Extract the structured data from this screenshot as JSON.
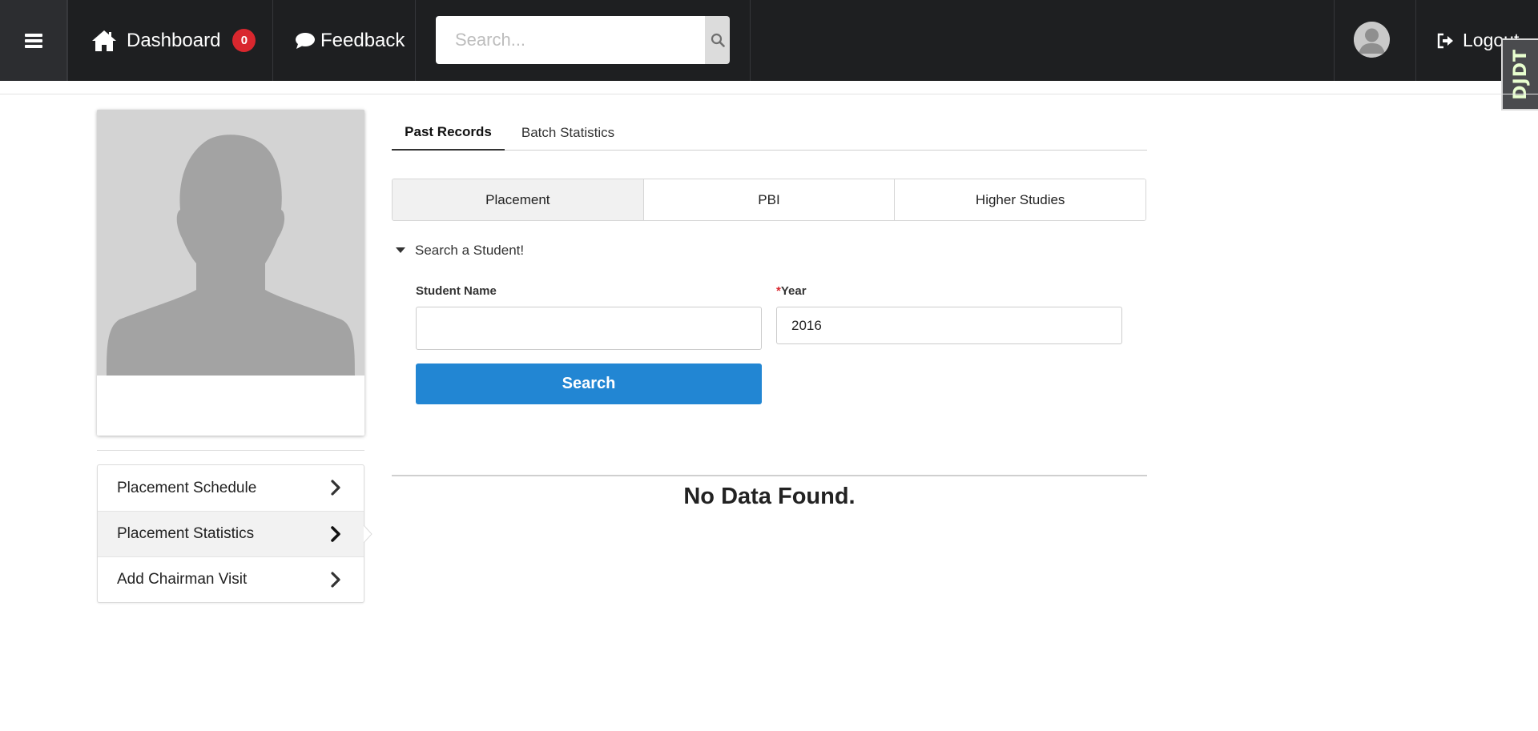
{
  "navbar": {
    "dashboard_label": "Dashboard",
    "notification_count": "0",
    "feedback_label": "Feedback",
    "search_placeholder": "Search...",
    "logout_label": "Logout",
    "extension_label": "DJDT"
  },
  "sidebar": {
    "items": [
      {
        "label": "Placement Schedule",
        "active": false
      },
      {
        "label": "Placement Statistics",
        "active": true
      },
      {
        "label": "Add Chairman Visit",
        "active": false
      }
    ]
  },
  "tabs": [
    {
      "label": "Past Records",
      "active": true
    },
    {
      "label": "Batch Statistics",
      "active": false
    }
  ],
  "segments": [
    {
      "label": "Placement",
      "active": true
    },
    {
      "label": "PBI",
      "active": false
    },
    {
      "label": "Higher Studies",
      "active": false
    }
  ],
  "search_form": {
    "toggle_label": "Search a Student!",
    "student_name_label": "Student Name",
    "student_name_value": "",
    "year_required_mark": "*",
    "year_label": "Year",
    "year_value": "2016",
    "submit_label": "Search"
  },
  "results": {
    "empty_message": "No Data Found."
  },
  "colors": {
    "navbar_bg": "#1e1f21",
    "badge_red": "#d9272e",
    "primary_blue": "#2286d3"
  },
  "icons": [
    "menu-icon",
    "home-icon",
    "comment-icon",
    "search-icon",
    "user-avatar-icon",
    "logout-icon",
    "chevron-right-icon",
    "caret-down-icon"
  ]
}
